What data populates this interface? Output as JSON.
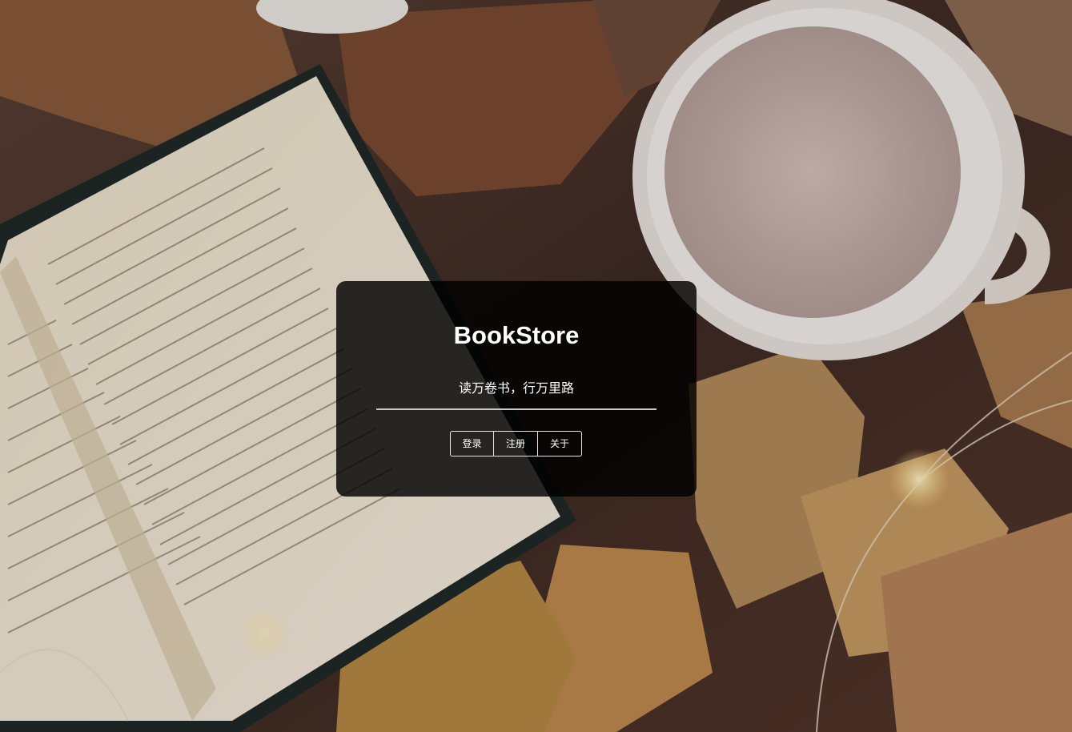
{
  "app": {
    "title": "BookStore",
    "slogan": "读万卷书，行万里路"
  },
  "nav": {
    "buttons": [
      {
        "label": "登录"
      },
      {
        "label": "注册"
      },
      {
        "label": "关于"
      }
    ]
  },
  "background": {
    "scene": "open-book-coffee-cup-autumn-leaves"
  },
  "colors": {
    "card_bg": "#000000",
    "text": "#ffffff",
    "divider": "#c9c9c9",
    "button_border": "#e6e6e6"
  }
}
